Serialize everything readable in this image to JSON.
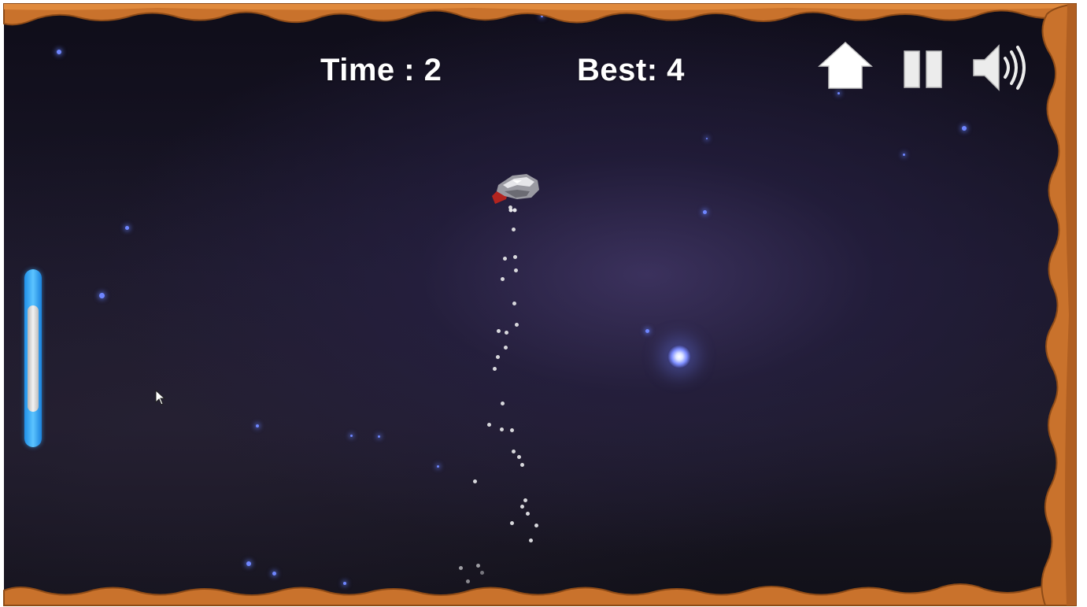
{
  "hud": {
    "time_label": "Time : 2",
    "best_label": "Best: 4"
  },
  "controls": {
    "home": "home-icon",
    "pause": "pause-icon",
    "sound": "speaker-icon"
  },
  "energy": {
    "level": 0.62
  },
  "colors": {
    "space": "#1a1729",
    "rock": "#c9722c",
    "rock_dark": "#a85a1e",
    "energy": "#4db8ff",
    "star": "#6f86ff"
  }
}
